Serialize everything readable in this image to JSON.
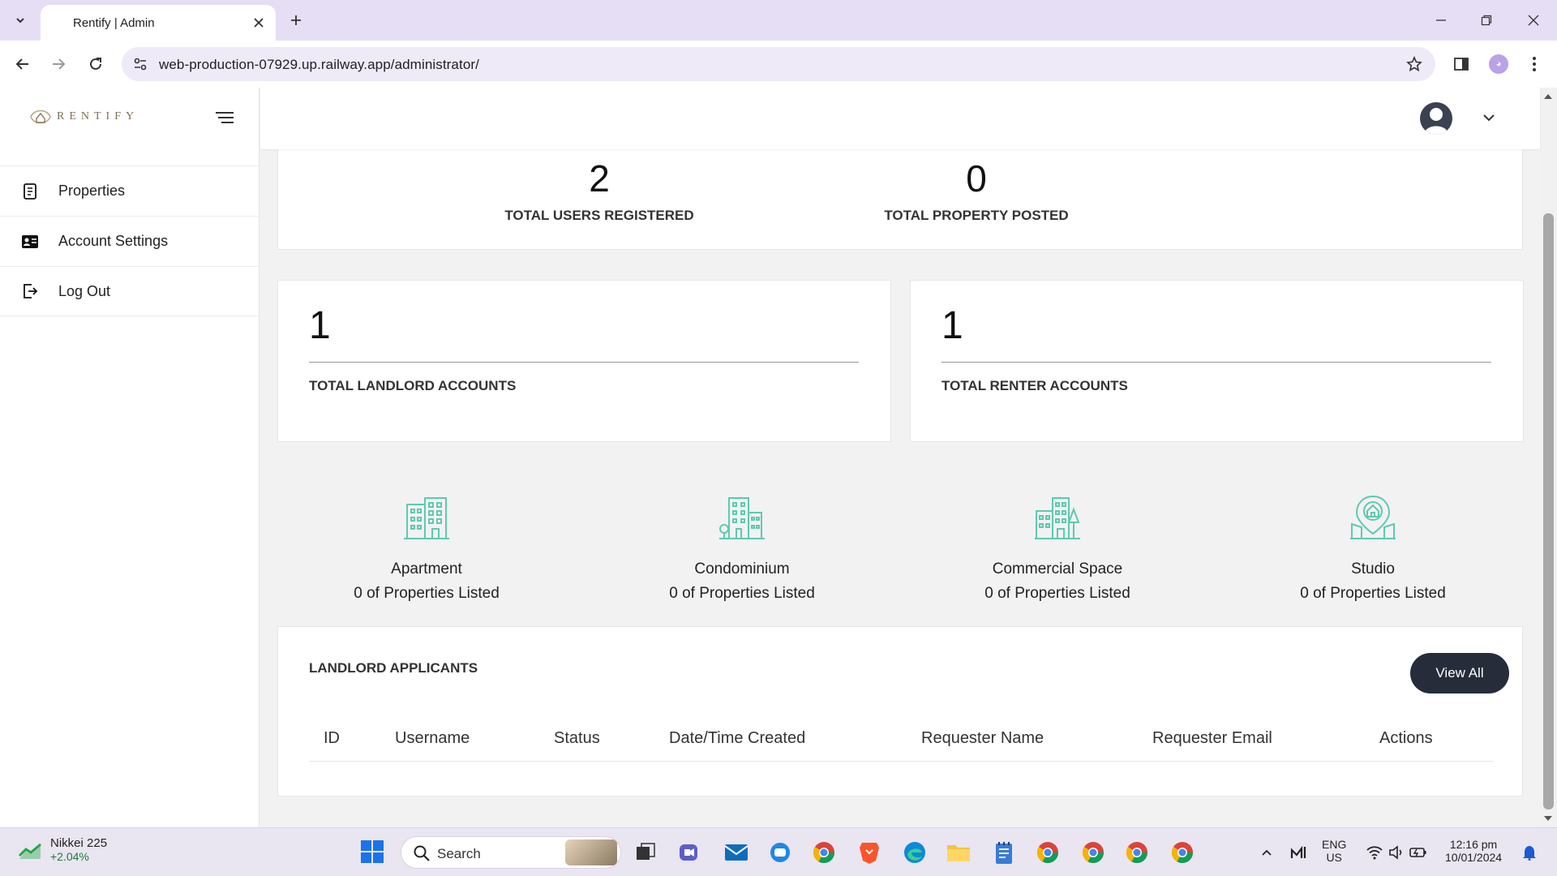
{
  "browser": {
    "tab_title": "Rentify | Admin",
    "url": "web-production-07929.up.railway.app/administrator/"
  },
  "sidebar": {
    "brand": "RENTIFY",
    "items": [
      {
        "label": "Properties",
        "icon": "document-icon"
      },
      {
        "label": "Account Settings",
        "icon": "id-card-icon"
      },
      {
        "label": "Log Out",
        "icon": "logout-icon"
      }
    ]
  },
  "stats": {
    "users": {
      "value": "2",
      "label": "TOTAL USERS REGISTERED"
    },
    "properties": {
      "value": "0",
      "label": "TOTAL PROPERTY POSTED"
    },
    "landlords": {
      "value": "1",
      "label": "TOTAL LANDLORD ACCOUNTS"
    },
    "renters": {
      "value": "1",
      "label": "TOTAL RENTER ACCOUNTS"
    }
  },
  "property_types": [
    {
      "name": "Apartment",
      "count": "0 of Properties Listed",
      "icon": "apartment-icon"
    },
    {
      "name": "Condominium",
      "count": "0 of Properties Listed",
      "icon": "condominium-icon"
    },
    {
      "name": "Commercial Space",
      "count": "0 of Properties Listed",
      "icon": "commercial-space-icon"
    },
    {
      "name": "Studio",
      "count": "0 of Properties Listed",
      "icon": "studio-icon"
    }
  ],
  "applicants": {
    "title": "LANDLORD APPLICANTS",
    "view_all": "View All",
    "columns": [
      "ID",
      "Username",
      "Status",
      "Date/Time Created",
      "Requester Name",
      "Requester Email",
      "Actions"
    ]
  },
  "taskbar": {
    "widget_title": "Nikkei 225",
    "widget_value": "+2.04%",
    "search_label": "Search",
    "lang_top": "ENG",
    "lang_bottom": "US",
    "time": "12:16 pm",
    "date": "10/01/2024"
  },
  "colors": {
    "accent_icon": "#5fc9b0",
    "button_dark": "#262c3a",
    "browser_frame": "#e6def5"
  }
}
